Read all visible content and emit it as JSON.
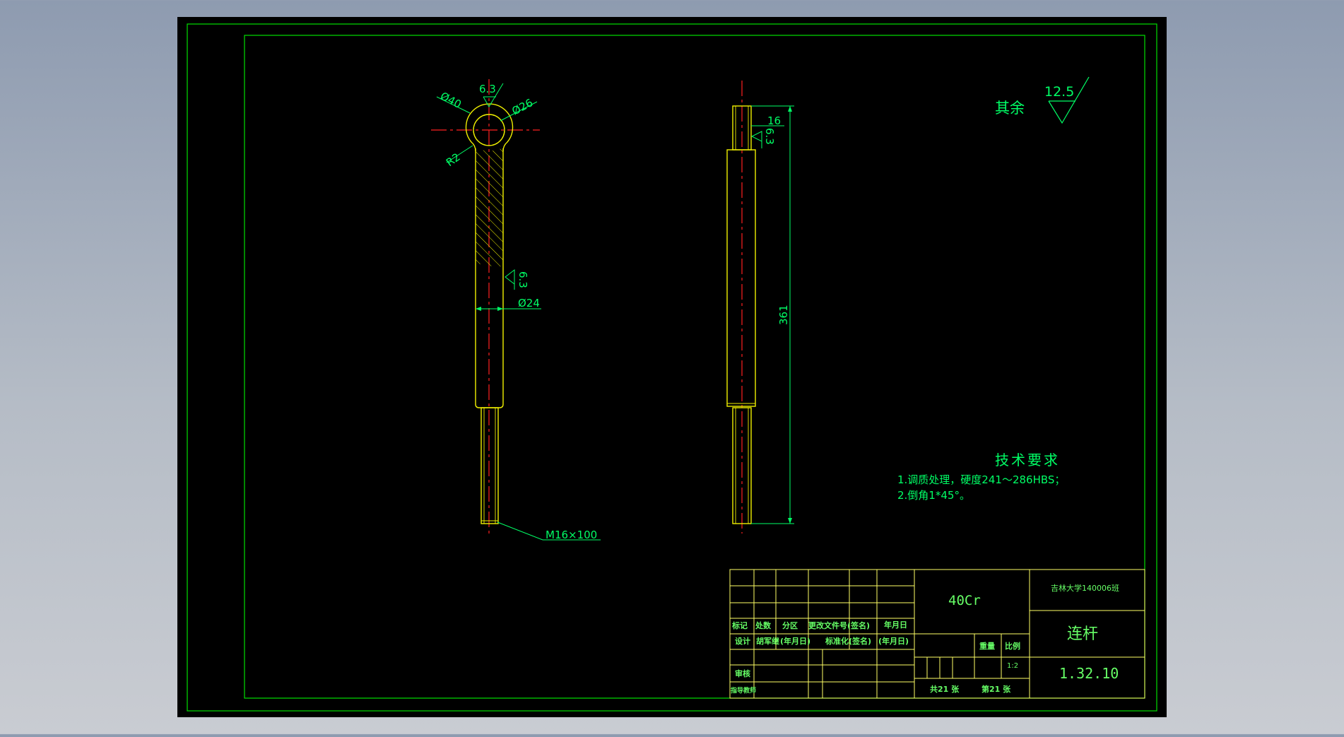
{
  "colors": {
    "viewport_bg": "#000000",
    "frame": "#00e000",
    "part_outline": "#f0f000",
    "dimension": "#00ff66",
    "centerline": "#ff2020",
    "title_grid": "#ffff66",
    "title_text": "#66ff66"
  },
  "drawing": {
    "surface_finish_label": "其余",
    "surface_finish_value": "12.5",
    "front_view": {
      "dim_eye_outer": "Ø40",
      "dim_eye_roughness": "6.3",
      "dim_eye_inner": "Ø26",
      "dim_fillet": "R2",
      "dim_shank_roughness": "6.3",
      "dim_shank_dia": "Ø24",
      "dim_thread": "M16×100"
    },
    "side_view": {
      "dim_eye_width": "16",
      "dim_roughness": "6.3",
      "dim_total_length": "361"
    },
    "tech_requirements": {
      "heading": "技术要求",
      "items": [
        "1.调质处理，硬度241～286HBS；",
        "2.倒角1*45°。"
      ]
    }
  },
  "title_block": {
    "material": "40Cr",
    "school": "吉林大学140006班",
    "part_name": "连杆",
    "drawing_number": "1.32.10",
    "scale": "1:2",
    "labels": {
      "mark": "标记",
      "count": "处数",
      "zone": "分区",
      "change_doc": "更改文件号(签名)",
      "date": "年月日",
      "design": "设计",
      "designer": "胡军继",
      "date_paren1": "(年月日)",
      "standardize": "标准化(签名)",
      "date_paren2": "(年月日)",
      "weight": "重量",
      "scale_label": "比例",
      "review": "审核",
      "advisor": "指导教师",
      "total_sheets": "共21 张",
      "sheet_no": "第21 张"
    }
  }
}
